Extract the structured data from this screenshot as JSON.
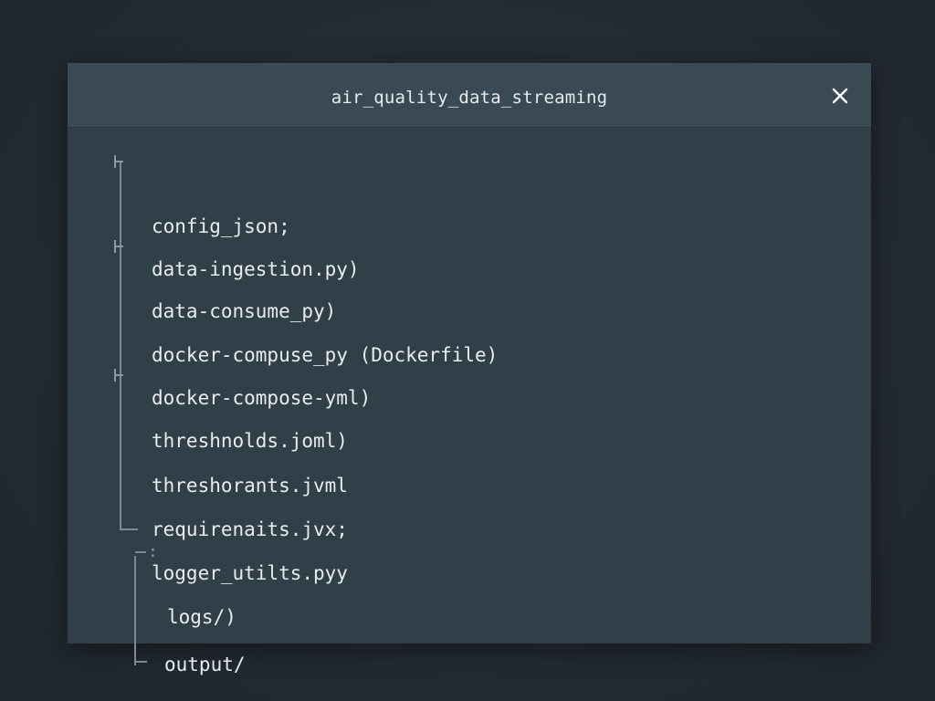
{
  "window": {
    "title": "air_quality_data_streaming",
    "close_icon": "close-icon"
  },
  "tree": {
    "entries": [
      {
        "label": "config_json;",
        "marker": "tee"
      },
      {
        "label": "data-ingestion.py)",
        "marker": "none"
      },
      {
        "label": "data-consume_py)",
        "marker": "tee"
      },
      {
        "label": "docker-compuse_py (Dockerfile)",
        "marker": "none"
      },
      {
        "label": "docker-compose-yml)",
        "marker": "none"
      },
      {
        "label": "threshnolds.joml)",
        "marker": "tee"
      },
      {
        "label": "threshorants.jvml",
        "marker": "none"
      },
      {
        "label": "requirenaits.jvx;",
        "marker": "elbow"
      },
      {
        "label": "logger_utilts.pyy",
        "marker": "none"
      },
      {
        "label": "logs/)",
        "marker": "colon"
      },
      {
        "label": "output/",
        "marker": "elbow"
      }
    ],
    "colon_marker_text": ":"
  },
  "colors": {
    "background": "#222a31",
    "window_body": "#313f48",
    "titlebar": "#3a4a54",
    "text": "#e8ecef",
    "tree_lines": "#7d8a92"
  }
}
